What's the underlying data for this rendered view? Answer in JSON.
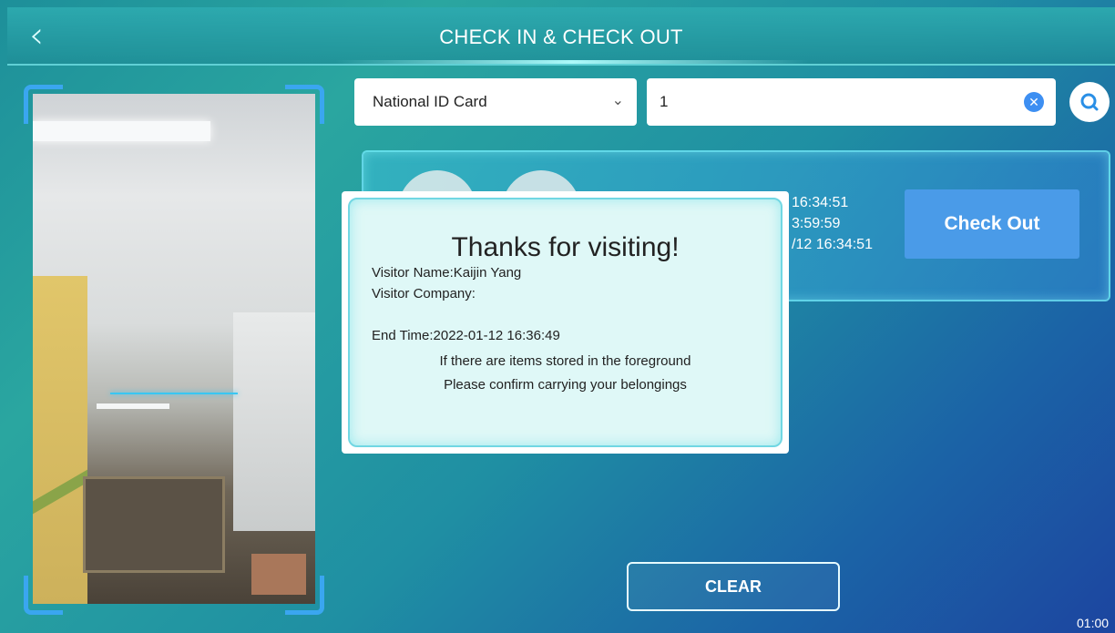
{
  "header": {
    "title": "CHECK IN & CHECK OUT",
    "back_icon": "chevron-left-icon"
  },
  "search": {
    "id_type": "National ID Card",
    "query": "1",
    "clear_icon": "close-circle-icon",
    "search_icon": "search-icon"
  },
  "visitor_card": {
    "time_lines": [
      "16:34:51",
      "3:59:59",
      "/12 16:34:51"
    ],
    "checkout_label": "Check Out"
  },
  "modal": {
    "heading": "Thanks for visiting!",
    "visitor_name": "Visitor Name:Kaijin Yang",
    "visitor_company": "Visitor Company:",
    "end_time": "End Time:2022-01-12 16:36:49",
    "notice_1": "If there are items stored in the foreground",
    "notice_2": "Please confirm carrying your belongings"
  },
  "footer": {
    "clear_label": "CLEAR",
    "clock": "01:00"
  },
  "colors": {
    "accent": "#4a9be8",
    "frame": "#3aa6f0",
    "modal_border": "#71d7e3"
  }
}
